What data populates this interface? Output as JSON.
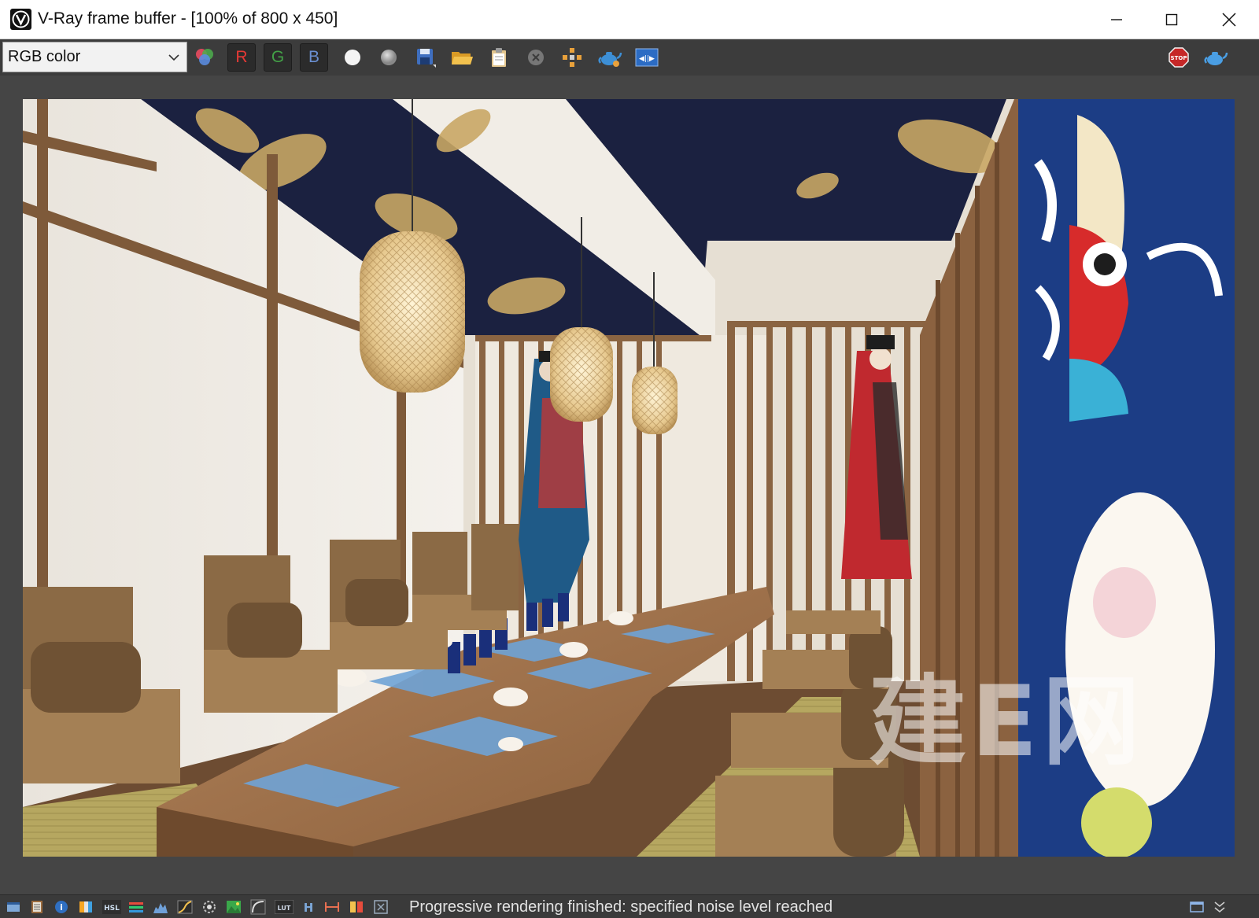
{
  "window": {
    "title": "V-Ray frame buffer - [100% of 800 x 450]"
  },
  "toolbar": {
    "channel_value": "RGB color",
    "channel_r": "R",
    "channel_g": "G",
    "channel_b": "B",
    "buttons": [
      "color-channels-icon",
      "red-channel-icon",
      "green-channel-icon",
      "blue-channel-icon",
      "white-circle-icon",
      "gray-circle-icon",
      "save-icon",
      "open-folder-icon",
      "clipboard-icon",
      "clear-icon",
      "track-region-icon",
      "render-teapot-icon",
      "lens-effects-icon",
      "stop-icon",
      "interactive-teapot-icon"
    ]
  },
  "render": {
    "watermark": "建E网"
  },
  "statusbar": {
    "message": "Progressive rendering finished: specified noise level reached",
    "hsl_label": "HSL",
    "lut_label": "LUT",
    "h_label": "H"
  },
  "colors": {
    "titlebar_bg": "#ffffff",
    "toolbar_bg": "#3c3c3c",
    "viewport_bg": "#454545",
    "statusbar_bg": "#3a3a3a",
    "channel_red": "#e53935",
    "channel_green": "#43a047",
    "channel_blue": "#6a8fd1"
  }
}
